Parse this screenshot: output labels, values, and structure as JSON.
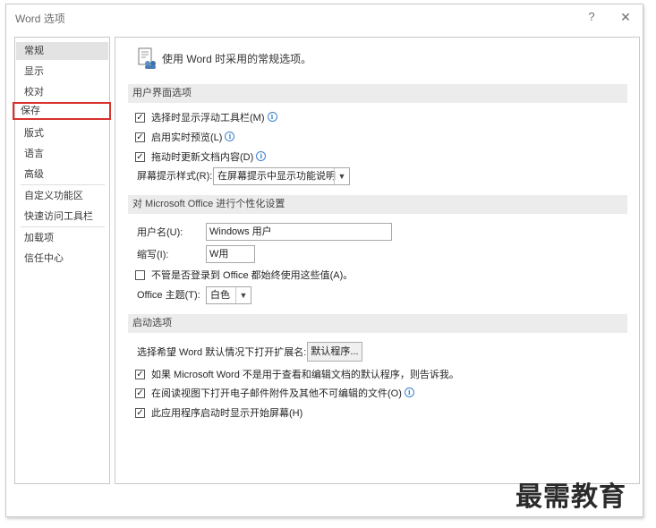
{
  "window": {
    "title": "Word 选项",
    "help_label": "?",
    "close_label": "✕"
  },
  "sidebar": {
    "items": [
      {
        "label": "常规"
      },
      {
        "label": "显示"
      },
      {
        "label": "校对"
      },
      {
        "label": "保存"
      },
      {
        "label": "版式"
      },
      {
        "label": "语言"
      },
      {
        "label": "高级"
      },
      {
        "label": "自定义功能区"
      },
      {
        "label": "快速访问工具栏"
      },
      {
        "label": "加载项"
      },
      {
        "label": "信任中心"
      }
    ]
  },
  "main": {
    "header_text": "使用 Word 时采用的常规选项。",
    "ui_section": {
      "title": "用户界面选项",
      "options": [
        {
          "label": "选择时显示浮动工具栏(M)",
          "checked": true
        },
        {
          "label": "启用实时预览(L)",
          "checked": true
        },
        {
          "label": "拖动时更新文档内容(D)",
          "checked": true
        }
      ],
      "screentip_label": "屏幕提示样式(R):",
      "screentip_value": "在屏幕提示中显示功能说明"
    },
    "personalize_section": {
      "title": "对 Microsoft Office 进行个性化设置",
      "username_label": "用户名(U):",
      "username_value": "Windows 用户",
      "initials_label": "缩写(I):",
      "initials_value": "W用",
      "always_use_label": "不管是否登录到 Office 都始终使用这些值(A)。",
      "always_use_checked": false,
      "theme_label": "Office 主题(T):",
      "theme_value": "白色"
    },
    "startup_section": {
      "title": "启动选项",
      "default_ext_label": "选择希望 Word 默认情况下打开扩展名:",
      "default_programs_button": "默认程序...",
      "options": [
        {
          "label": "如果 Microsoft Word 不是用于查看和编辑文档的默认程序，则告诉我。",
          "checked": true
        },
        {
          "label": "在阅读视图下打开电子邮件附件及其他不可编辑的文件(O)",
          "checked": true
        },
        {
          "label": "此应用程序启动时显示开始屏幕(H)",
          "checked": true
        }
      ]
    }
  },
  "watermark": "最需教育",
  "icons": [
    "options-icon",
    "info-icon",
    "chevron-down-icon",
    "checkbox-check-icon"
  ],
  "colors": {
    "highlight_border": "#d9332d",
    "section_bar": "#ececec",
    "info_icon": "#3d7fc9"
  }
}
